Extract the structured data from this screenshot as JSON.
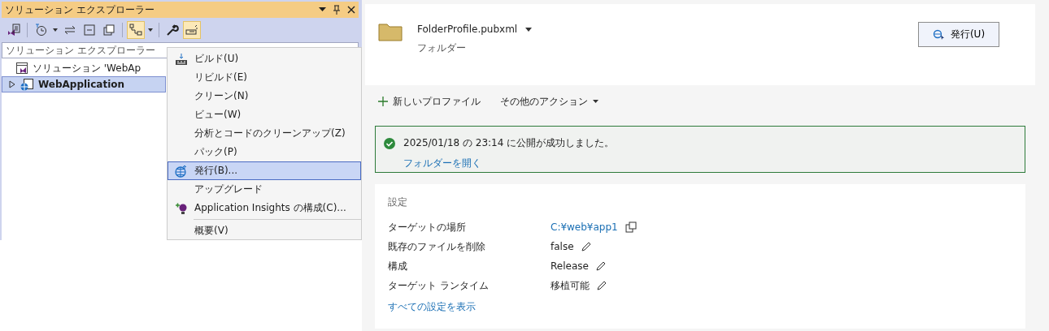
{
  "explorer": {
    "title": "ソリューション エクスプローラー",
    "toolbar": [
      {
        "kind": "vs",
        "selected": false
      },
      {
        "kind": "history",
        "selected": false
      },
      {
        "kind": "sync",
        "selected": false
      },
      {
        "kind": "collapse",
        "selected": false
      },
      {
        "kind": "copy",
        "selected": false
      },
      {
        "kind": "tree",
        "selected": true
      },
      {
        "kind": "wrench",
        "selected": false
      },
      {
        "kind": "preview",
        "selected": true
      }
    ],
    "search": {
      "placeholder": "ソリューション エクスプローラー"
    },
    "tree": [
      {
        "label": "ソリューション 'WebAp",
        "kind": "solution",
        "selected": false
      },
      {
        "label": "WebApplication",
        "kind": "project",
        "selected": true,
        "expanded": false
      }
    ]
  },
  "context_menu": [
    {
      "label": "ビルド(U)",
      "kind": "build",
      "selected": false,
      "separator_before": false
    },
    {
      "label": "リビルド(E)",
      "kind": "plain",
      "selected": false,
      "separator_before": false
    },
    {
      "label": "クリーン(N)",
      "kind": "plain",
      "selected": false,
      "separator_before": false
    },
    {
      "label": "ビュー(W)",
      "kind": "plain",
      "selected": false,
      "separator_before": false
    },
    {
      "label": "分析とコードのクリーンアップ(Z)",
      "kind": "plain",
      "selected": false,
      "separator_before": false
    },
    {
      "label": "パック(P)",
      "kind": "plain",
      "selected": false,
      "separator_before": false
    },
    {
      "label": "発行(B)...",
      "kind": "publish",
      "selected": true,
      "separator_before": false
    },
    {
      "label": "アップグレード",
      "kind": "plain",
      "selected": false,
      "separator_before": false
    },
    {
      "label": "Application Insights の構成(C)...",
      "kind": "insights",
      "selected": false,
      "separator_before": false
    },
    {
      "label": "概要(V)",
      "kind": "plain",
      "selected": false,
      "separator_before": true
    }
  ],
  "profile": {
    "name": "FolderProfile.pubxml",
    "type": "フォルダー",
    "publish_button": "発行(U)"
  },
  "actions": [
    {
      "label": "新しいプロファイル",
      "kind": "add"
    },
    {
      "label": "その他のアクション",
      "kind": "dropdown"
    }
  ],
  "status": {
    "message": "2025/01/18 の 23:14 に公開が成功しました。",
    "link": "フォルダーを開く"
  },
  "settings": {
    "title": "設定",
    "rows": [
      {
        "label": "ターゲットの場所",
        "value": "C:¥web¥app1",
        "kind": "link"
      },
      {
        "label": "既存のファイルを削除",
        "value": "false",
        "kind": "edit"
      },
      {
        "label": "構成",
        "value": "Release",
        "kind": "edit"
      },
      {
        "label": "ターゲット ランタイム",
        "value": "移植可能",
        "kind": "edit"
      }
    ],
    "show_all": "すべての設定を表示"
  }
}
